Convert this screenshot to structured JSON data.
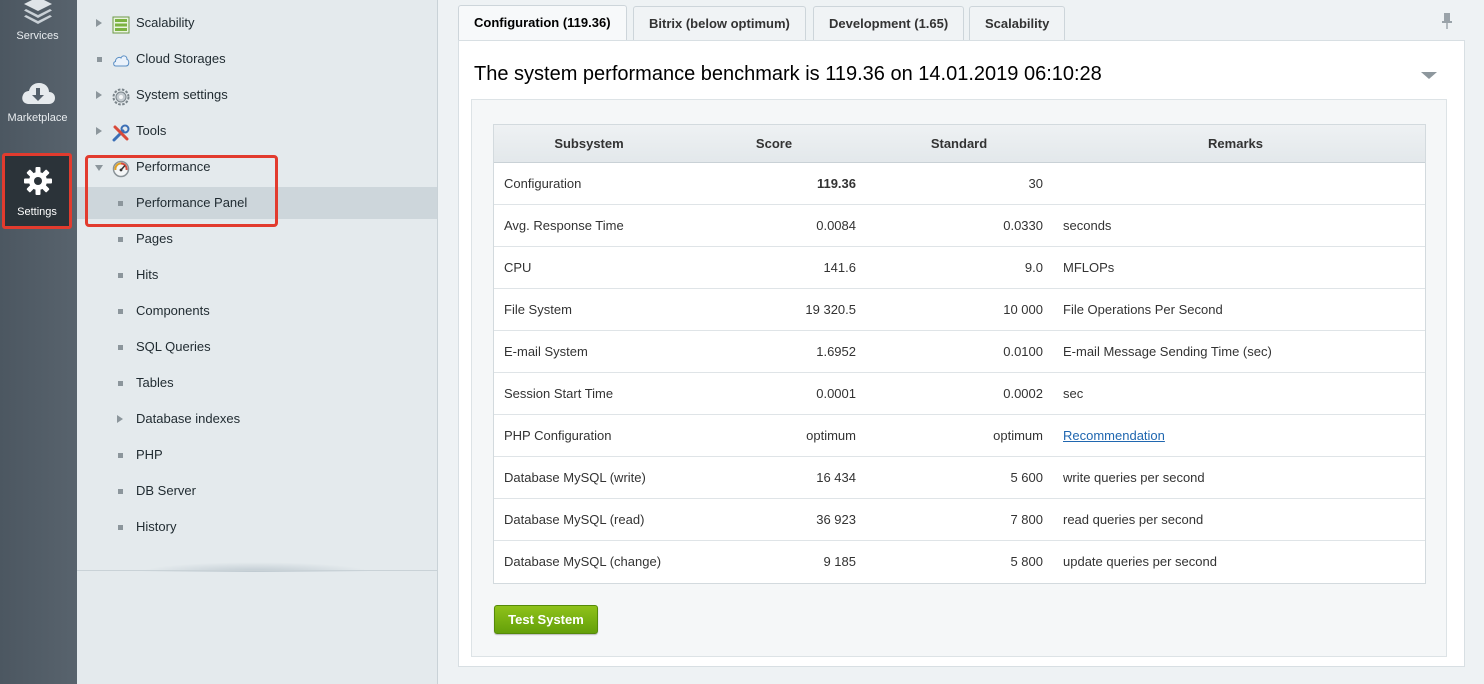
{
  "rail": {
    "services_label": "Services",
    "marketplace_label": "Marketplace",
    "settings_label": "Settings"
  },
  "tree": {
    "items": [
      {
        "label": "Scalability",
        "icon": "scalability-icon",
        "expander": "arrow"
      },
      {
        "label": "Cloud Storages",
        "icon": "cloud-storage-icon",
        "expander": "bullet"
      },
      {
        "label": "System settings",
        "icon": "gear-icon",
        "expander": "arrow"
      },
      {
        "label": "Tools",
        "icon": "tools-icon",
        "expander": "arrow"
      },
      {
        "label": "Performance",
        "icon": "speedometer-icon",
        "expander": "open"
      }
    ],
    "children": [
      {
        "label": "Performance Panel",
        "selected": true
      },
      {
        "label": "Pages"
      },
      {
        "label": "Hits"
      },
      {
        "label": "Components"
      },
      {
        "label": "SQL Queries"
      },
      {
        "label": "Tables"
      },
      {
        "label": "Database indexes",
        "expander": "arrow"
      },
      {
        "label": "PHP"
      },
      {
        "label": "DB Server"
      },
      {
        "label": "History"
      }
    ]
  },
  "tabs": [
    {
      "label": "Configuration (119.36)",
      "active": true
    },
    {
      "label": "Bitrix (below optimum)"
    },
    {
      "label": "Development (1.65)"
    },
    {
      "label": "Scalability"
    }
  ],
  "panel": {
    "title": "The system performance benchmark is 119.36 on 14.01.2019 06:10:28"
  },
  "table": {
    "headers": [
      "Subsystem",
      "Score",
      "Standard",
      "Remarks"
    ],
    "rows": [
      {
        "subsystem": "Configuration",
        "score": "119.36",
        "standard": "30",
        "remarks": ""
      },
      {
        "subsystem": "Avg. Response Time",
        "score": "0.0084",
        "standard": "0.0330",
        "remarks": "seconds"
      },
      {
        "subsystem": "CPU",
        "score": "141.6",
        "standard": "9.0",
        "remarks": "MFLOPs"
      },
      {
        "subsystem": "File System",
        "score": "19 320.5",
        "standard": "10 000",
        "remarks": "File Operations Per Second"
      },
      {
        "subsystem": "E-mail System",
        "score": "1.6952",
        "standard": "0.0100",
        "remarks": "E-mail Message Sending Time (sec)"
      },
      {
        "subsystem": "Session Start Time",
        "score": "0.0001",
        "standard": "0.0002",
        "remarks": "sec"
      },
      {
        "subsystem": "PHP Configuration",
        "score": "optimum",
        "standard": "optimum",
        "remarks": "Recommendation",
        "remarks_link": true
      },
      {
        "subsystem": "Database MySQL (write)",
        "score": "16 434",
        "standard": "5 600",
        "remarks": "write queries per second"
      },
      {
        "subsystem": "Database MySQL (read)",
        "score": "36 923",
        "standard": "7 800",
        "remarks": "read queries per second"
      },
      {
        "subsystem": "Database MySQL (change)",
        "score": "9 185",
        "standard": "5 800",
        "remarks": "update queries per second"
      }
    ]
  },
  "buttons": {
    "test_system": "Test System"
  },
  "colors": {
    "highlight": "#e23b2e",
    "button_green": "#7ab317",
    "link": "#2067b0"
  }
}
